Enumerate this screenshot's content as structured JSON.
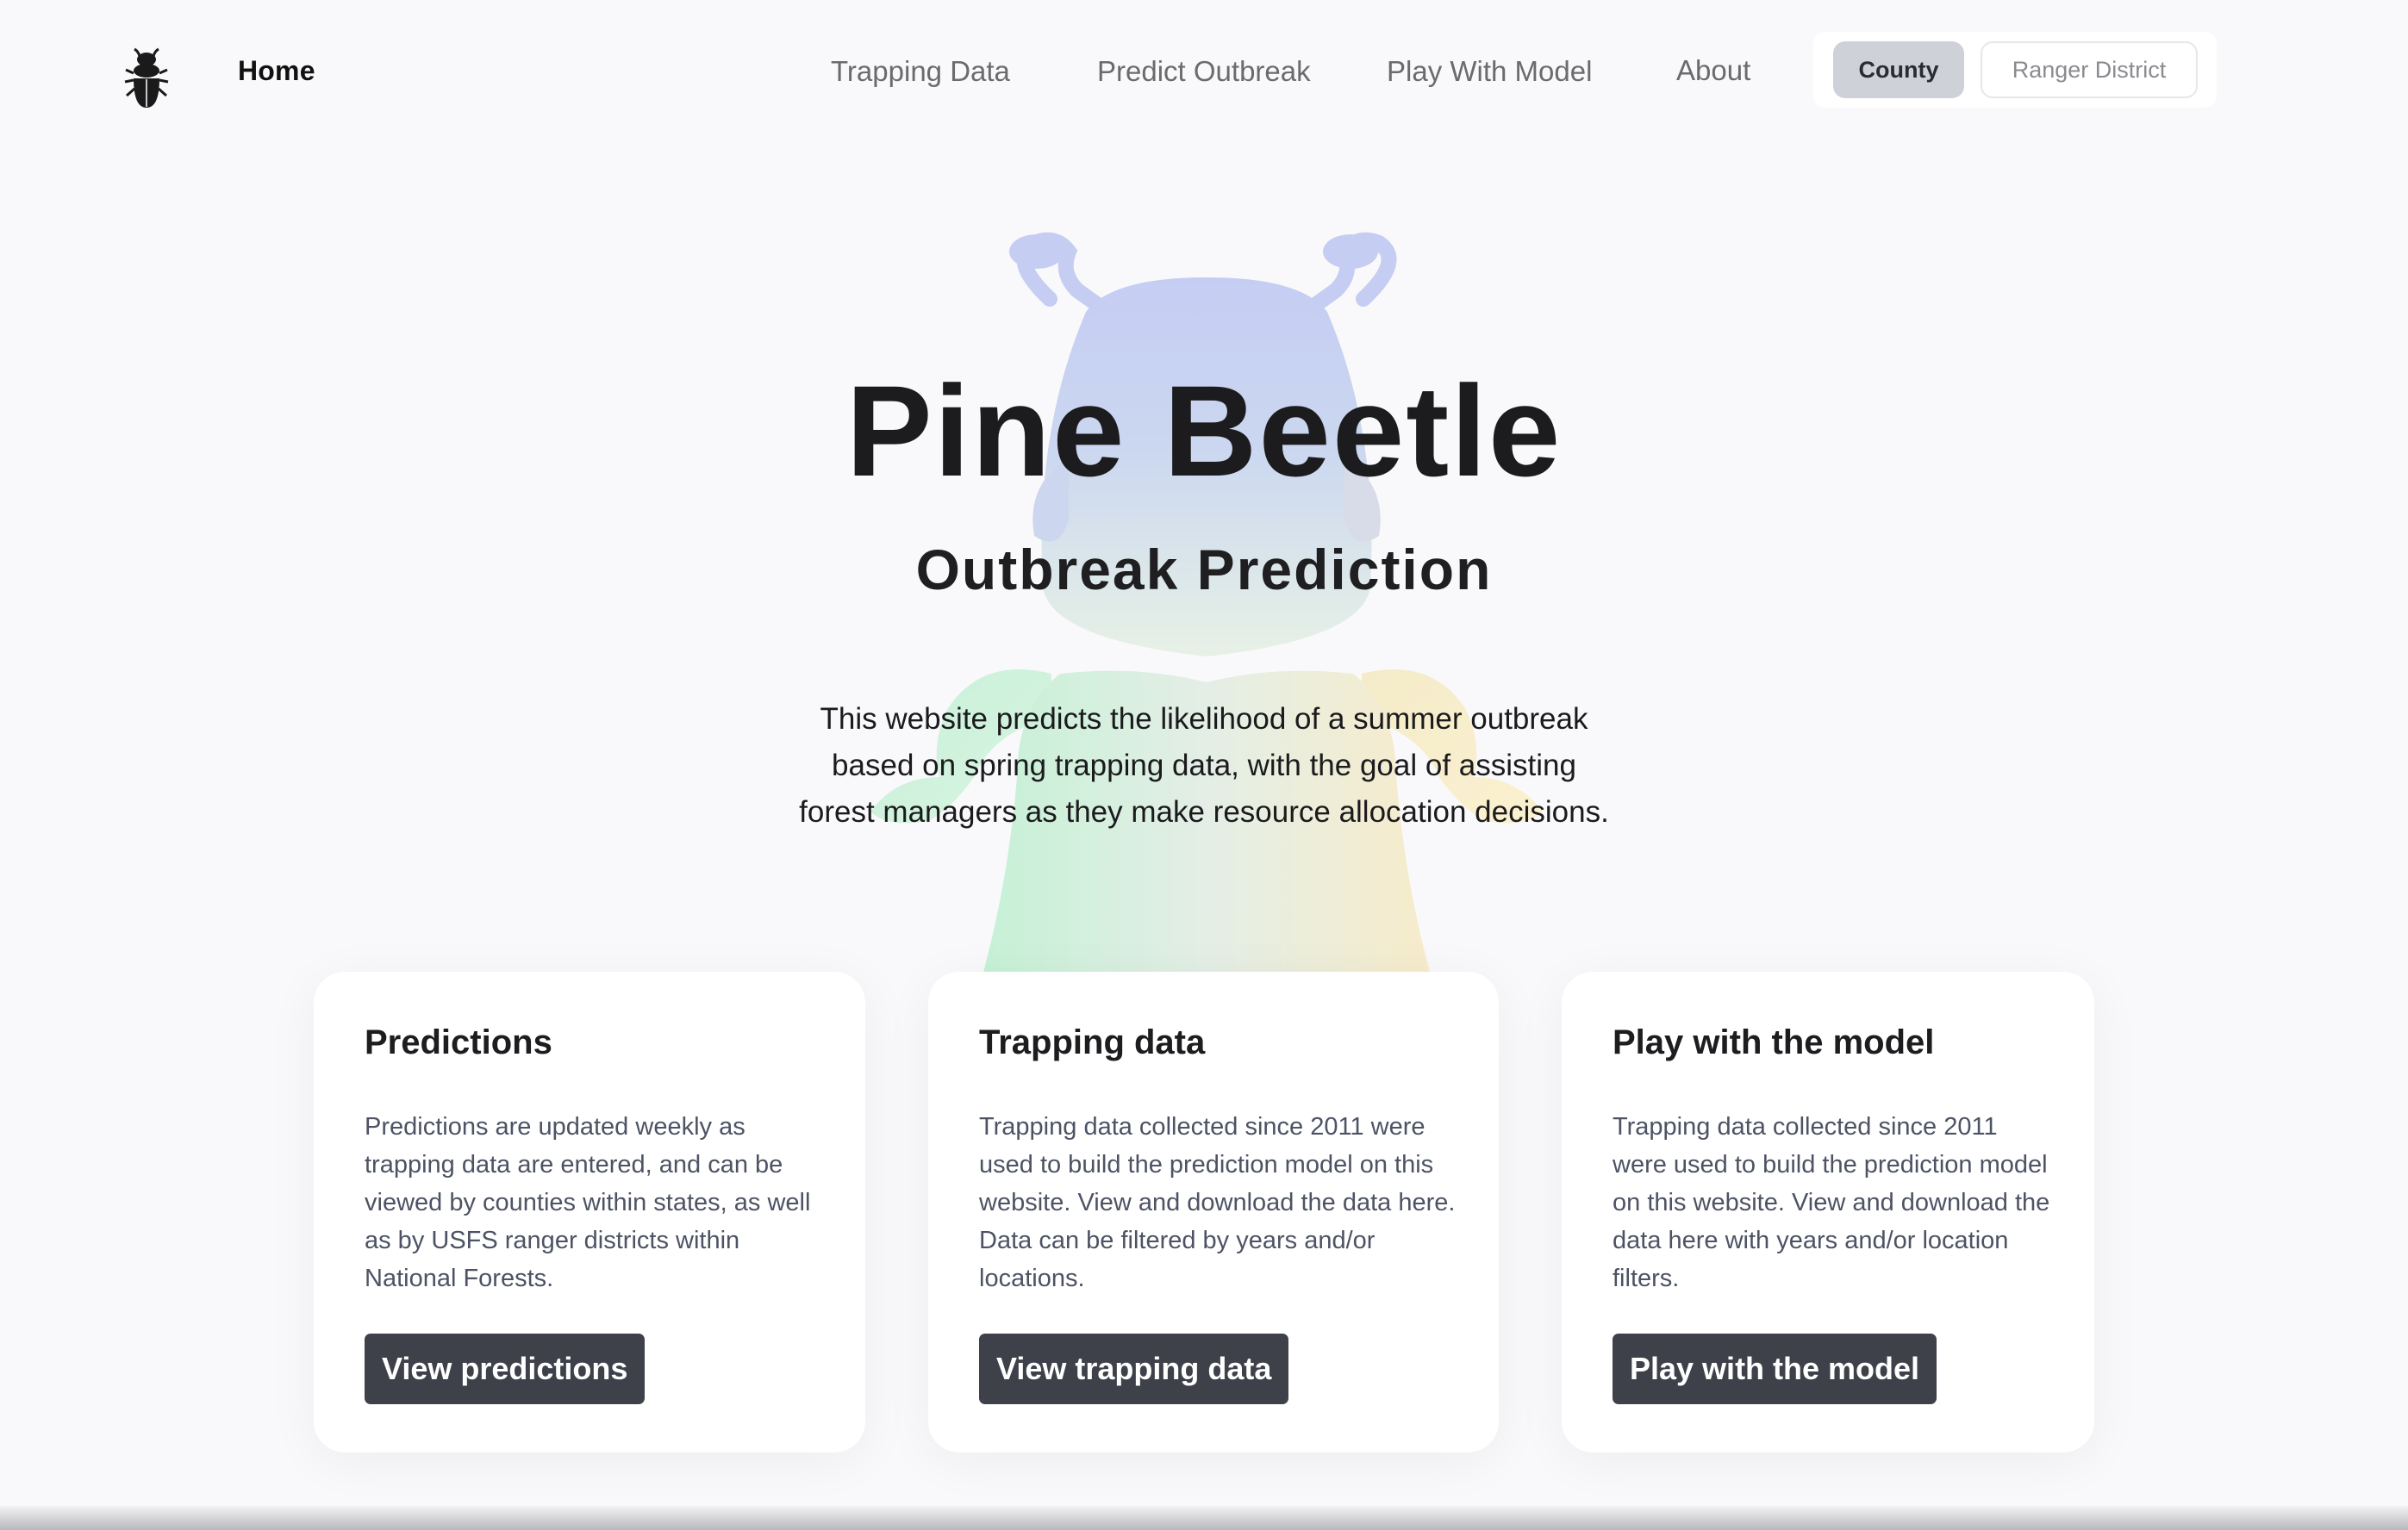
{
  "nav": {
    "home_label": "Home",
    "links": [
      {
        "label": "Trapping Data"
      },
      {
        "label": "Predict Outbreak"
      },
      {
        "label": "Play With Model"
      },
      {
        "label": "About"
      }
    ],
    "toggle": {
      "county_label": "County",
      "ranger_label": "Ranger District",
      "selected": "County"
    }
  },
  "hero": {
    "title": "Pine Beetle",
    "subtitle": "Outbreak Prediction",
    "description": "This website predicts the likelihood of a summer outbreak based on spring trapping data, with the goal of assisting forest managers as they make resource allocation decisions."
  },
  "cards": [
    {
      "title": "Predictions",
      "text": "Predictions are updated weekly as trapping data are entered, and can be viewed by counties within states, as well as by USFS ranger districts within National Forests.",
      "button": "View predictions"
    },
    {
      "title": "Trapping data",
      "text": "Trapping data collected since 2011 were used to build the prediction model on this website. View and download the data here. Data can be filtered by years and/or locations.",
      "button": "View trapping data"
    },
    {
      "title": "Play with the model",
      "text": "Trapping data collected since 2011 were used to build the prediction model on this website. View and download the data here with years and/or location filters.",
      "button": "Play with the model"
    }
  ],
  "colors": {
    "background": "#f9f9fb",
    "button_dark": "#3e414a",
    "toggle_selected": "#cfd1d8"
  },
  "icons": {
    "logo": "beetle-icon"
  }
}
